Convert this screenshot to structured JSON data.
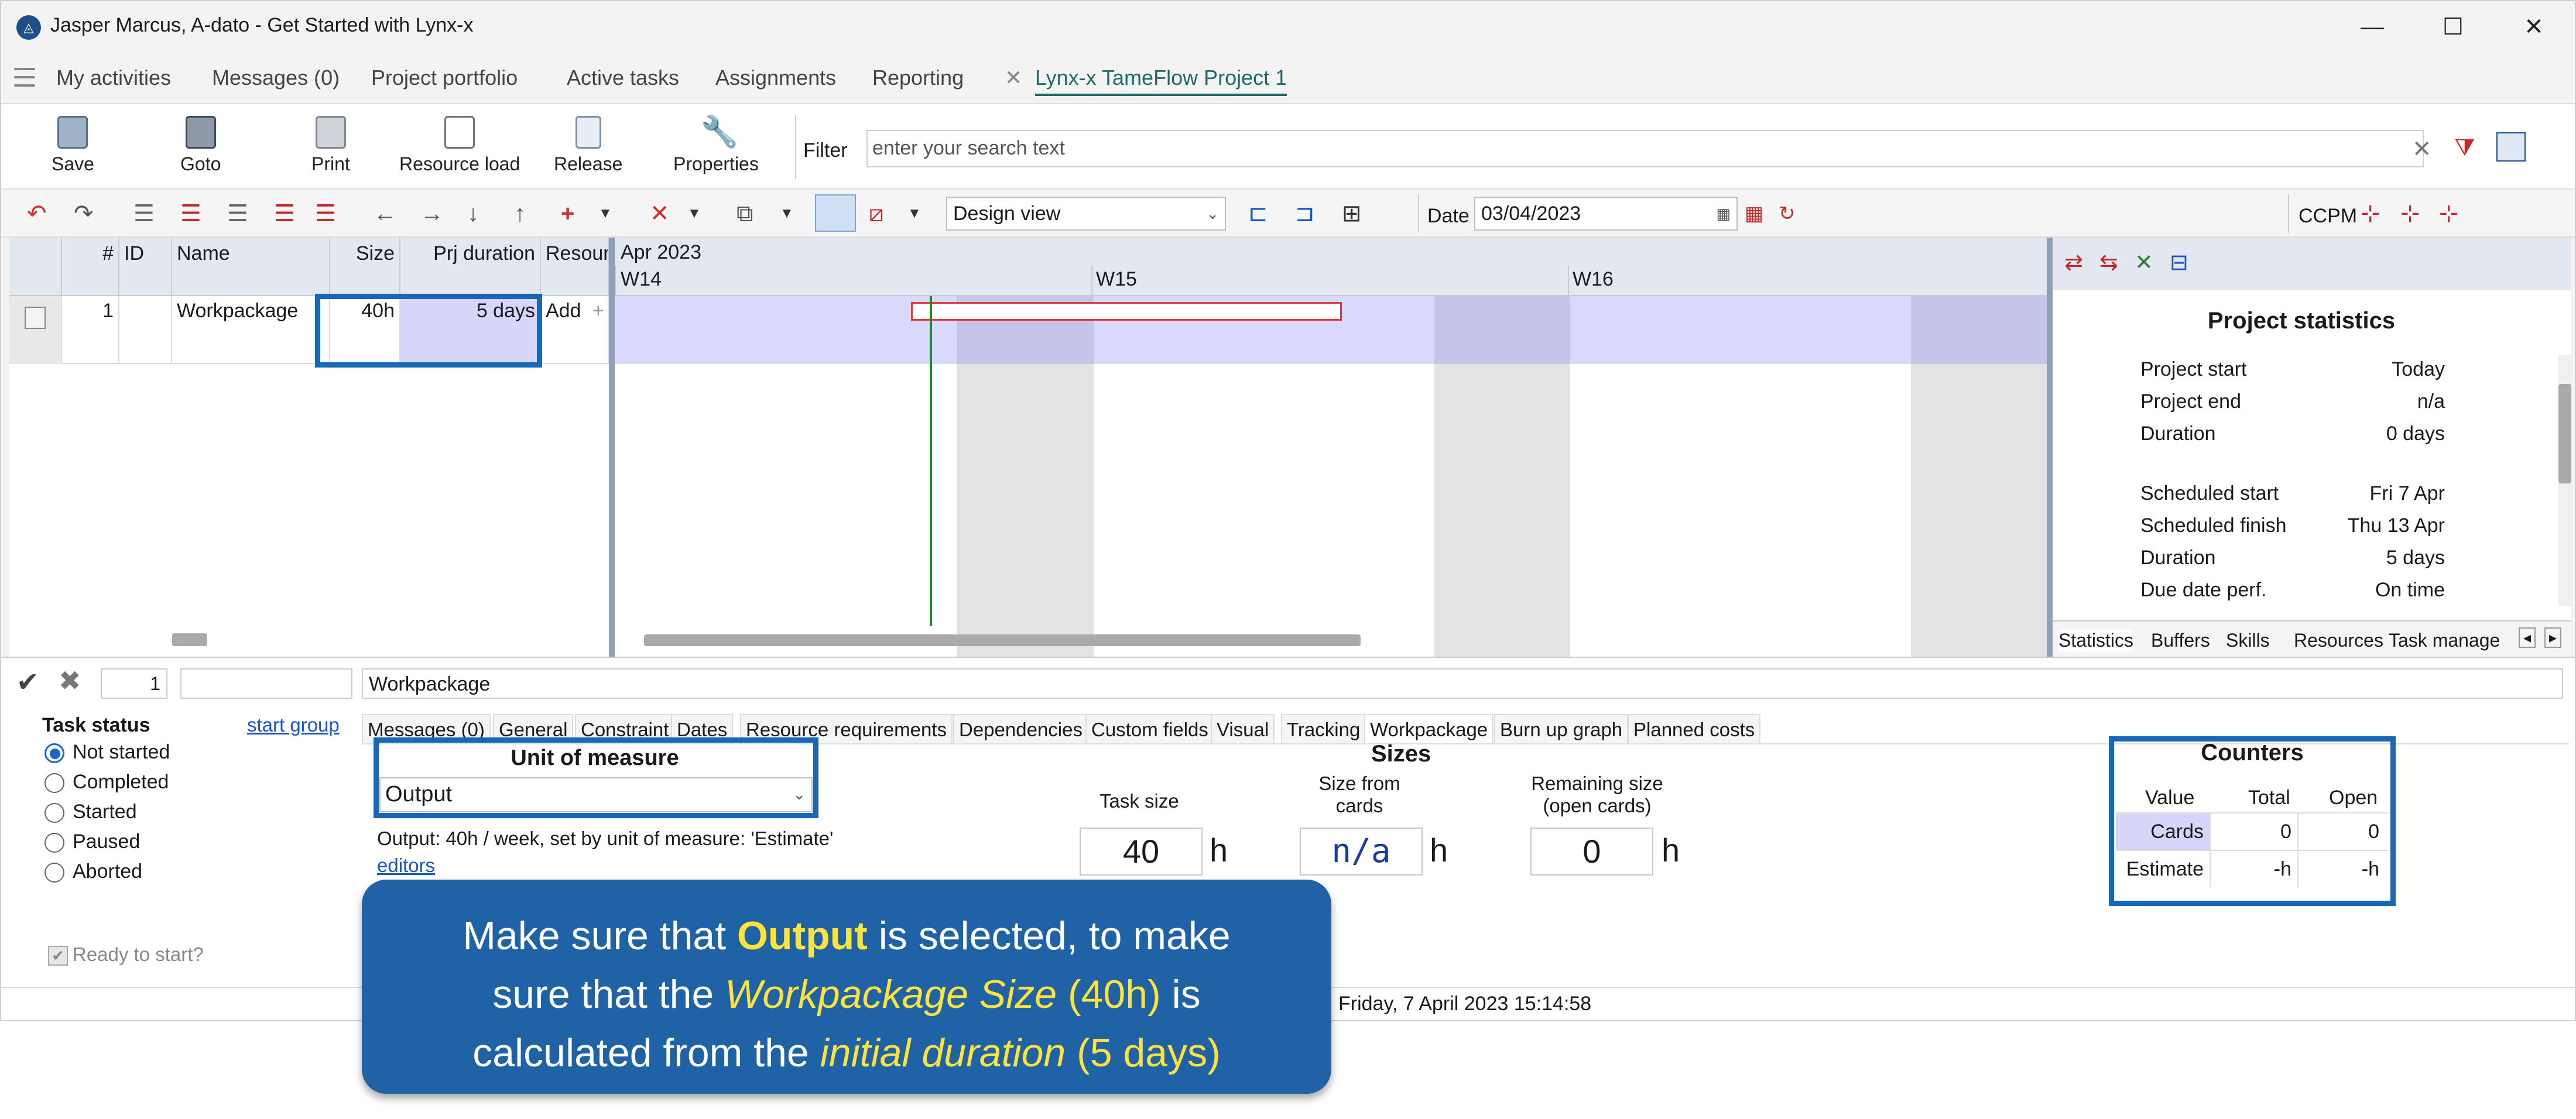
{
  "window": {
    "title": "Jasper Marcus, A-dato - Get Started with Lynx-x",
    "minimize": "—",
    "maximize": "☐",
    "close": "✕"
  },
  "menu": {
    "items": [
      "My activities",
      "Messages (0)",
      "Project portfolio",
      "Active tasks",
      "Assignments",
      "Reporting"
    ],
    "active_tab": "Lynx-x TameFlow Project 1",
    "active_tab_close": "✕"
  },
  "toolbar": {
    "save": "Save",
    "goto": "Goto",
    "print": "Print",
    "resource_load": "Resource load",
    "release": "Release",
    "properties": "Properties",
    "filter_label": "Filter",
    "filter_placeholder": "enter your search text"
  },
  "toolbar2": {
    "view_select": "Design view",
    "date_label": "Date",
    "date_value": "03/04/2023",
    "ccpm_label": "CCPM"
  },
  "grid": {
    "headers": [
      "#",
      "ID",
      "Name",
      "Size",
      "Prj duration",
      "Resourc"
    ],
    "row": {
      "num": "1",
      "id": "",
      "name": "Workpackage",
      "size": "40h",
      "duration": "5 days",
      "resource": "Add"
    }
  },
  "gantt": {
    "month": "Apr 2023",
    "weeks": [
      "W14",
      "W15",
      "W16"
    ]
  },
  "stats": {
    "title": "Project statistics",
    "rows_a": [
      {
        "label": "Project start",
        "value": "Today"
      },
      {
        "label": "Project end",
        "value": "n/a"
      },
      {
        "label": "Duration",
        "value": "0 days"
      }
    ],
    "rows_b": [
      {
        "label": "Scheduled start",
        "value": "Fri 7 Apr"
      },
      {
        "label": "Scheduled finish",
        "value": "Thu 13 Apr"
      },
      {
        "label": "Duration",
        "value": "5 days"
      },
      {
        "label": "Due date perf.",
        "value": "On time"
      }
    ],
    "tabs": [
      "Statistics",
      "Buffers",
      "Skills",
      "Resources",
      "Task manage"
    ]
  },
  "detail": {
    "id_field": "1",
    "name_field": "Workpackage",
    "task_status_label": "Task status",
    "start_group": "start group",
    "statuses": [
      "Not started",
      "Completed",
      "Started",
      "Paused",
      "Aborted"
    ],
    "ready_label": "Ready to start?",
    "tabs": [
      "Messages (0)",
      "General",
      "Constraint",
      "Dates",
      "Resource requirements",
      "Dependencies",
      "Custom fields",
      "Visual",
      "Tracking",
      "Workpackage",
      "Burn up graph",
      "Planned costs"
    ],
    "unit_of_measure_label": "Unit of measure",
    "unit_of_measure_value": "Output",
    "output_note": "Output: 40h / week, set by unit of measure: 'Estimate'",
    "editors_link": "editors",
    "sizes_label": "Sizes",
    "task_size_label": "Task size",
    "size_from_cards_label_1": "Size from",
    "size_from_cards_label_2": "cards",
    "remaining_label_1": "Remaining size",
    "remaining_label_2": "(open cards)",
    "task_size_value": "40",
    "size_from_cards_value": "n/a",
    "remaining_value": "0",
    "unit_h": "h",
    "status_time": "Friday, 7 April 2023 15:14:58",
    "counters": {
      "title": "Counters",
      "headers": [
        "Value",
        "Total",
        "Open"
      ],
      "rows": [
        {
          "label": "Cards",
          "total": "0",
          "open": "0"
        },
        {
          "label": "Estimate",
          "total": "-h",
          "open": "-h"
        }
      ]
    }
  },
  "callout": {
    "l1a": "Make sure that ",
    "l1b": "Output",
    "l1c": " is selected, to make",
    "l2a": "sure that the ",
    "l2b": "Workpackage Size",
    "l2c": " (40h)",
    "l2d": " is",
    "l3a": "calculated from the ",
    "l3b": "initial duration",
    "l3c": " (5 days)"
  }
}
